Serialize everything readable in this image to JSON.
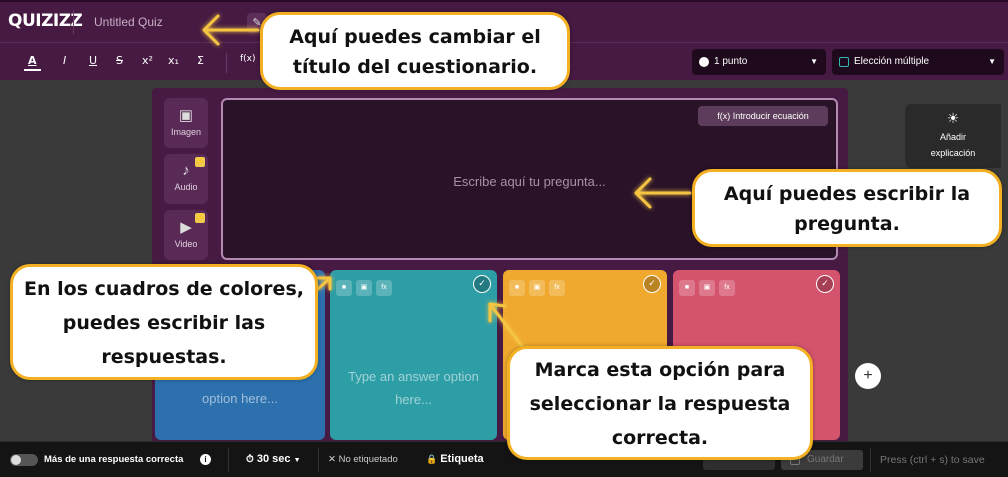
{
  "header": {
    "logo": "QUIZIZZ",
    "quiz_title": "Untitled Quiz",
    "edit_icon": "pencil-icon"
  },
  "toolbar": {
    "format_buttons": [
      "A",
      "I",
      "U",
      "S",
      "x²",
      "x₁",
      "Σ",
      "f(x)"
    ],
    "points": "1 punto",
    "question_type": "Elección múltiple",
    "caret": "▼"
  },
  "media": {
    "image": "Imagen",
    "audio": "Audio",
    "video": "Video"
  },
  "question": {
    "equation_button": "f(x) Introducir ecuación",
    "placeholder": "Escribe aquí tu pregunta..."
  },
  "answers": {
    "card1_text": "option here...",
    "card2_text": "Type an answer option here...",
    "tools": [
      "trash-icon",
      "image-icon",
      "formula-icon"
    ],
    "check": "✓"
  },
  "right_panel": {
    "add_explanation": "Añadir explicación",
    "add_button": "+"
  },
  "bottom": {
    "multi_correct": "Más de una respuesta correcta",
    "info": "i",
    "timer": "30 sec",
    "untagged": "No etiquetado",
    "tag": "Etiqueta",
    "save": "Guardar",
    "save_hint": "Press (ctrl + s) to save"
  },
  "callouts": {
    "title": "Aquí puedes cambiar el título del cuestionario.",
    "question": "Aquí puedes escribir la pregunta.",
    "answers": "En los cuadros de colores, puedes escribir las respuestas.",
    "correct": "Marca esta opción para seleccionar la respuesta correcta."
  },
  "colors": {
    "header": "#461a42",
    "answer_blue": "#2d70ae",
    "answer_teal": "#2d9da6",
    "answer_orange": "#f0a92e",
    "answer_red": "#d5546d",
    "callout_border": "#f2b022"
  }
}
